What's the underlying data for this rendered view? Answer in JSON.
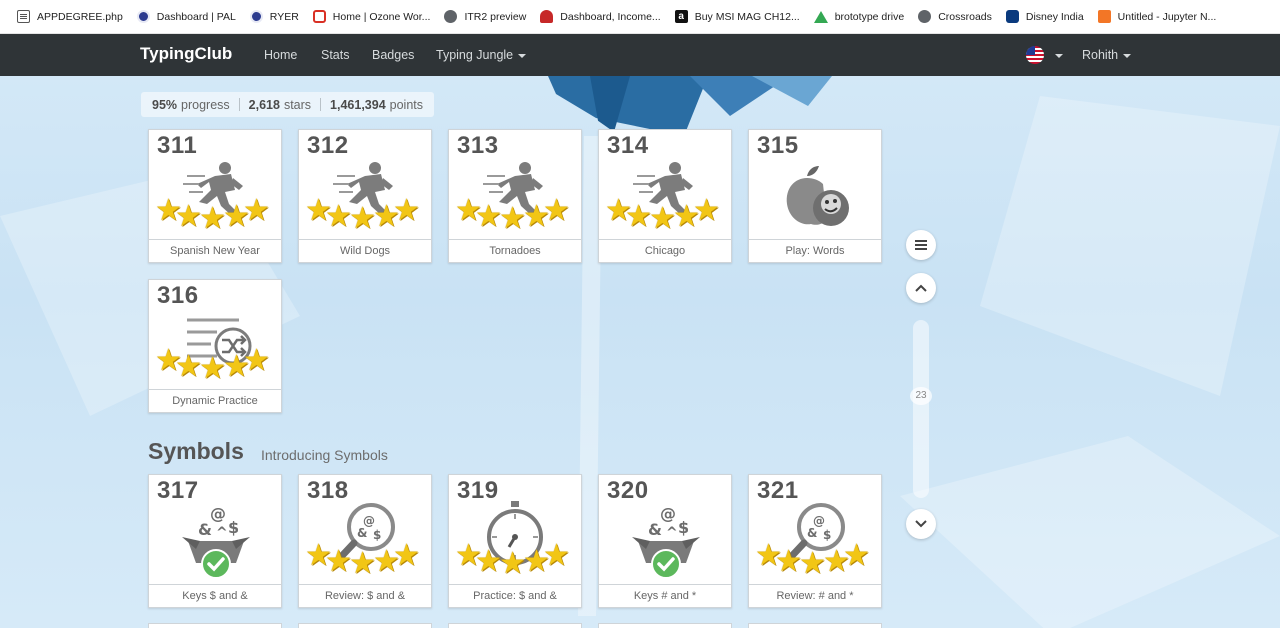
{
  "bookmarks": [
    {
      "label": "APPDEGREE.php",
      "icon": "doc-icon"
    },
    {
      "label": "Dashboard | PAL",
      "icon": "ring-icon"
    },
    {
      "label": "RYER",
      "icon": "ring-icon"
    },
    {
      "label": "Home | Ozone Wor...",
      "icon": "square-icon"
    },
    {
      "label": "ITR2 preview",
      "icon": "globe-icon"
    },
    {
      "label": "Dashboard, Income...",
      "icon": "oz-icon"
    },
    {
      "label": "Buy MSI MAG CH12...",
      "icon": "amazon-icon"
    },
    {
      "label": "brototype drive",
      "icon": "drive-icon"
    },
    {
      "label": "Crossroads",
      "icon": "globe-icon"
    },
    {
      "label": "Disney India",
      "icon": "disney-icon"
    },
    {
      "label": "Untitled - Jupyter N...",
      "icon": "jupyter-icon"
    }
  ],
  "navbar": {
    "brand": "TypingClub",
    "links": [
      "Home",
      "Stats",
      "Badges",
      "Typing Jungle"
    ],
    "user": "Rohith"
  },
  "progress": {
    "percent": "95%",
    "percent_label": "progress",
    "stars": "2,618",
    "stars_label": "stars",
    "points": "1,461,394",
    "points_label": "points"
  },
  "lessons": [
    {
      "num": "311",
      "title": "Spanish New Year",
      "icon": "runner-icon",
      "stars": 5
    },
    {
      "num": "312",
      "title": "Wild Dogs",
      "icon": "runner-icon",
      "stars": 5
    },
    {
      "num": "313",
      "title": "Tornadoes",
      "icon": "runner-icon",
      "stars": 5
    },
    {
      "num": "314",
      "title": "Chicago",
      "icon": "runner-icon",
      "stars": 5
    },
    {
      "num": "315",
      "title": "Play: Words",
      "icon": "apple-game-icon",
      "stars": 0
    },
    {
      "num": "316",
      "title": "Dynamic Practice",
      "icon": "shuffle-list-icon",
      "stars": 5
    }
  ],
  "section": {
    "title": "Symbols",
    "subtitle": "Introducing Symbols"
  },
  "symbol_lessons": [
    {
      "num": "317",
      "title": "Keys $ and &",
      "icon": "symbol-box-check-icon",
      "stars": 0
    },
    {
      "num": "318",
      "title": "Review: $ and &",
      "icon": "magnifier-symbols-icon",
      "stars": 5
    },
    {
      "num": "319",
      "title": "Practice: $ and &",
      "icon": "stopwatch-icon",
      "stars": 5
    },
    {
      "num": "320",
      "title": "Keys # and *",
      "icon": "symbol-box-check-icon",
      "stars": 0
    },
    {
      "num": "321",
      "title": "Review: # and *",
      "icon": "magnifier-symbols-icon",
      "stars": 5
    }
  ],
  "scroll": {
    "label": "23"
  }
}
